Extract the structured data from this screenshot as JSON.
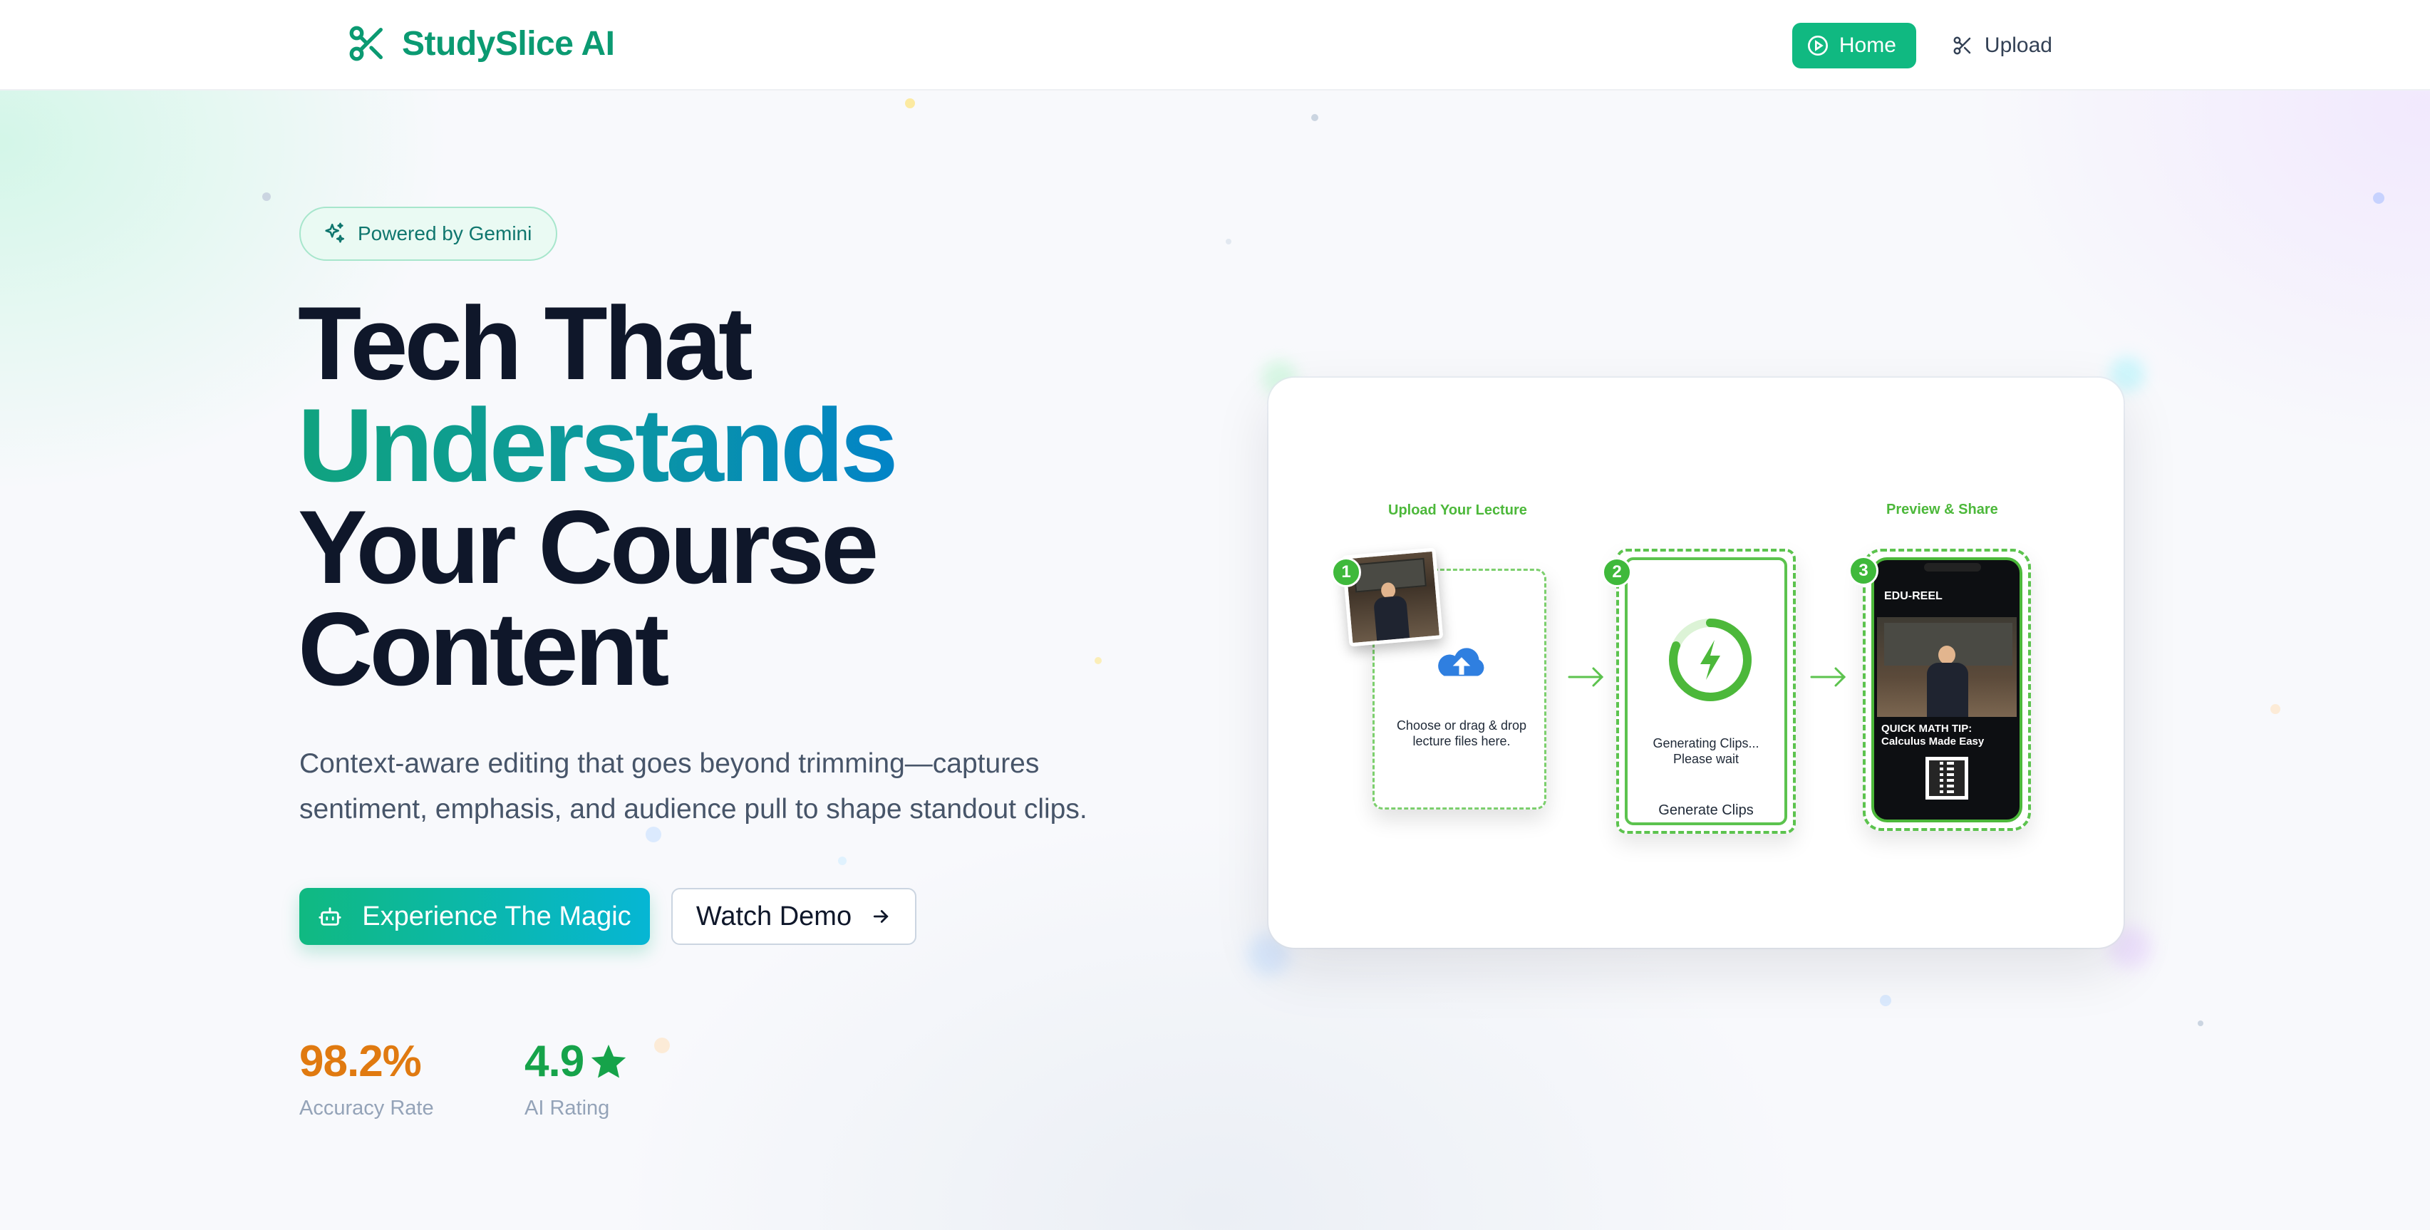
{
  "header": {
    "brand": "StudySlice AI",
    "nav": [
      {
        "label": "Home",
        "icon": "play-circle-icon",
        "active": true
      },
      {
        "label": "Upload",
        "icon": "scissors-icon",
        "active": false
      }
    ]
  },
  "hero": {
    "badge": "Powered by Gemini",
    "headline_line1": "Tech That",
    "headline_line2": "Understands",
    "headline_line3": "Your Course",
    "headline_line4": "Content",
    "subtitle": "Context-aware editing that goes beyond trimming—captures sentiment, emphasis, and audience pull to shape standout clips.",
    "primary_cta": "Experience The Magic",
    "secondary_cta": "Watch Demo"
  },
  "stats": [
    {
      "value": "98.2%",
      "label": "Accuracy Rate",
      "color": "#e07a10"
    },
    {
      "value": "4.9",
      "label": "AI Rating",
      "color": "#16a34a"
    }
  ],
  "preview": {
    "step1_title": "Upload Your Lecture",
    "step1_number": "1",
    "step1_text": "Choose or drag & drop lecture files here.",
    "step2_number": "2",
    "step2_text_a": "Generating Clips...",
    "step2_text_b": "Please wait",
    "step2_button": "Generate Clips",
    "step3_title": "Preview & Share",
    "step3_number": "3",
    "phone_header": "EDU-REEL",
    "phone_caption_a": "QUICK MATH TIP:",
    "phone_caption_b": "Calculus Made Easy"
  },
  "colors": {
    "brand": "#0b9a72",
    "accent_green": "#10b981",
    "accent_cyan": "#06b6d4",
    "step_green": "#3fb93b",
    "headline": "#0f172a"
  }
}
